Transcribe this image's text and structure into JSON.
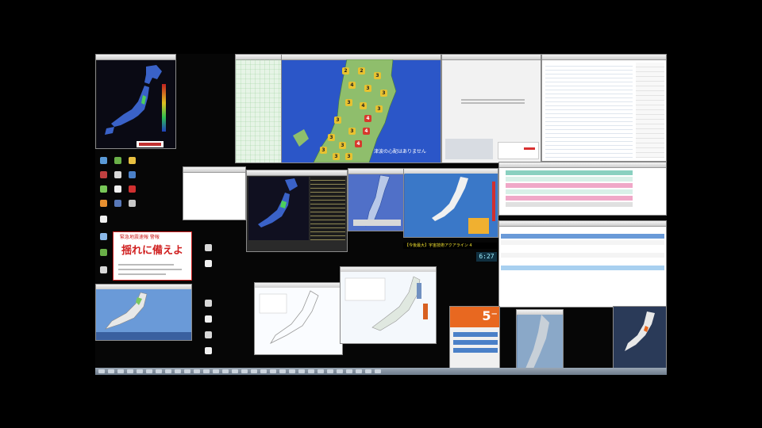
{
  "colors": {
    "background": "#000000",
    "desktop": "#060606",
    "japan_map_blue": "#2b56c8",
    "japan_land": "#8fbe6c",
    "alert_red": "#d8202a"
  },
  "map_window": {
    "badge_values": [
      "2",
      "2",
      "3",
      "4",
      "3",
      "3",
      "3",
      "4",
      "3",
      "4",
      "3",
      "3",
      "4",
      "3",
      "3",
      "4",
      "3",
      "3",
      "3"
    ],
    "message": "津波の心配はありません"
  },
  "alert_window": {
    "header": "緊急地震速報 警報",
    "headline": "揺れに備えよ"
  },
  "clock": {
    "time": "6:27"
  },
  "intensity_panel": {
    "value": "5⁻"
  },
  "stream_bar": {
    "text": "【今後最大】宇宙技術アクアライン 4"
  }
}
